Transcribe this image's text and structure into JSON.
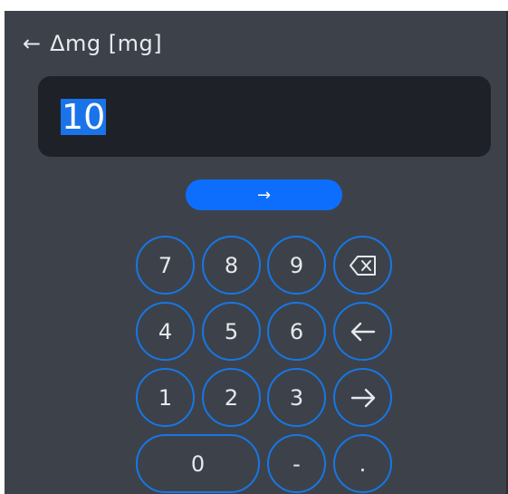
{
  "header": {
    "back_icon": "←",
    "title": "Δmg [mg]"
  },
  "input": {
    "value": "10"
  },
  "enter_button": {
    "label": "→"
  },
  "keypad": {
    "keys": {
      "k7": "7",
      "k8": "8",
      "k9": "9",
      "k4": "4",
      "k5": "5",
      "k6": "6",
      "k1": "1",
      "k2": "2",
      "k3": "3",
      "k0": "0",
      "minus": "-",
      "dot": "."
    },
    "icons": {
      "backspace": "backspace-icon",
      "cursor_left": "arrow-left-icon",
      "cursor_right": "arrow-right-icon"
    }
  },
  "colors": {
    "background": "#3d424a",
    "field": "#1e2127",
    "accent": "#0d6efd",
    "key_border": "#1677e6",
    "selection": "#1a73e8"
  }
}
